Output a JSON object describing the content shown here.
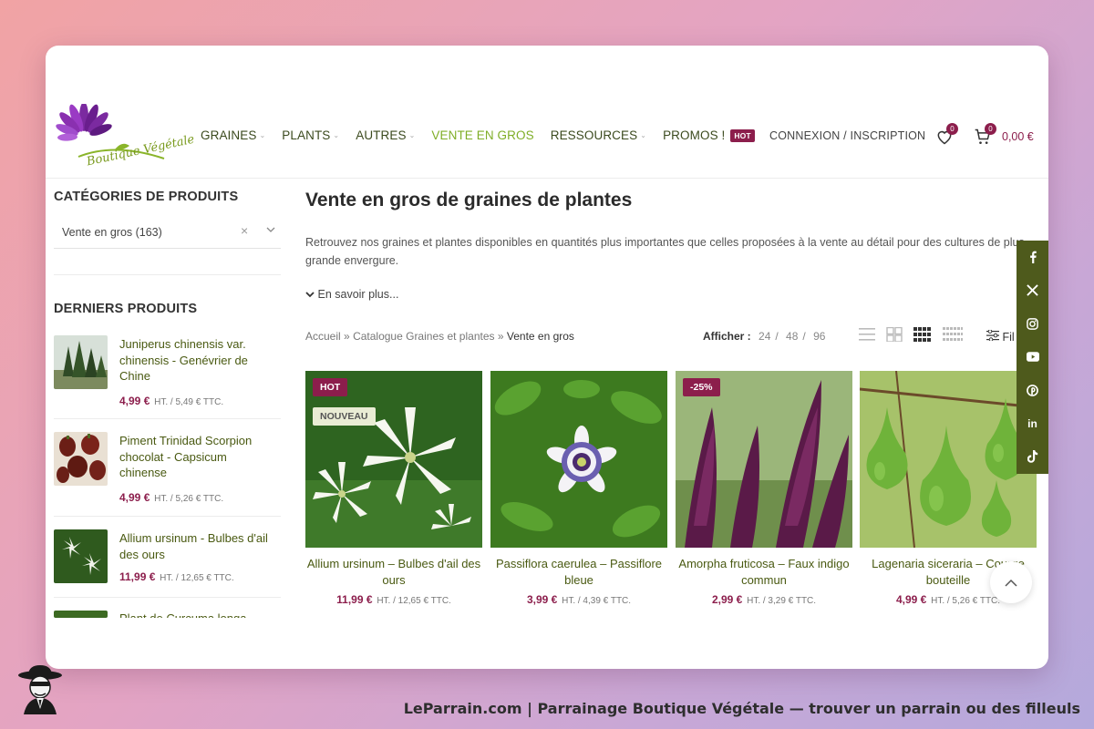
{
  "logo": {
    "text": "Boutique Végétale"
  },
  "nav": [
    {
      "label": "GRAINES",
      "dropdown": true
    },
    {
      "label": "PLANTS",
      "dropdown": true
    },
    {
      "label": "AUTRES",
      "dropdown": true
    },
    {
      "label": "VENTE EN GROS",
      "active": true
    },
    {
      "label": "RESSOURCES",
      "dropdown": true
    },
    {
      "label": "PROMOS !",
      "badge": "HOT"
    }
  ],
  "header": {
    "login": "CONNEXION / INSCRIPTION",
    "wishlist_count": "0",
    "cart_count": "0",
    "cart_total": "0,00 €"
  },
  "sidebar": {
    "categories_title": "CATÉGORIES DE PRODUITS",
    "category_select": "Vente en gros  (163)",
    "recent_title": "DERNIERS PRODUITS",
    "recent": [
      {
        "name": "Juniperus chinensis var. chinensis - Genévrier de Chine",
        "price": "4,99 €",
        "price_suffix": "HT. / 5,49 € TTC."
      },
      {
        "name": "Piment Trinidad Scorpion chocolat - Capsicum chinense",
        "price": "4,99 €",
        "price_suffix": "HT. / 5,26 € TTC."
      },
      {
        "name": "Allium ursinum - Bulbes d'ail des ours",
        "price": "11,99 €",
        "price_suffix": "HT. / 12,65 € TTC."
      },
      {
        "name": "Plant de Curcuma longa"
      }
    ]
  },
  "main": {
    "title": "Vente en gros de graines de plantes",
    "description": "Retrouvez nos graines et plantes disponibles en quantités plus importantes que celles proposées à la vente au détail pour des cultures de plus grande envergure.",
    "read_more": "En savoir plus...",
    "breadcrumb": {
      "home": "Accueil",
      "sep": "»",
      "catalog": "Catalogue Graines et plantes",
      "current": "Vente en gros"
    },
    "per_page": {
      "label": "Afficher :",
      "options": [
        "24",
        "48",
        "96"
      ],
      "sep": "/"
    },
    "filter_label": "Fil"
  },
  "products": [
    {
      "name": "Allium ursinum – Bulbes d'ail des ours",
      "price": "11,99 €",
      "price_suffix": "HT. / 12,65 € TTC.",
      "badges": [
        "HOT",
        "NOUVEAU"
      ]
    },
    {
      "name": "Passiflora caerulea – Passiflore bleue",
      "price": "3,99 €",
      "price_suffix": "HT. / 4,39 € TTC.",
      "badges": []
    },
    {
      "name": "Amorpha fruticosa – Faux indigo commun",
      "price": "2,99 €",
      "price_suffix": "HT. / 3,29 € TTC.",
      "badges": [
        "-25%"
      ]
    },
    {
      "name": "Lagenaria siceraria – Courge bouteille",
      "price": "4,99 €",
      "price_suffix": "HT. / 5,26 € TTC.",
      "badges": []
    }
  ],
  "social": [
    "facebook-icon",
    "x-icon",
    "instagram-icon",
    "youtube-icon",
    "pinterest-icon",
    "linkedin-icon",
    "tiktok-icon"
  ],
  "social_labels": {
    "linkedin": "in"
  },
  "footer": {
    "text": "LeParrain.com | Parrainage Boutique Végétale — trouver un parrain ou des filleuls"
  },
  "colors": {
    "accent": "#8c1e4c",
    "green": "#7fae27",
    "dark_green": "#4e5a1c"
  }
}
